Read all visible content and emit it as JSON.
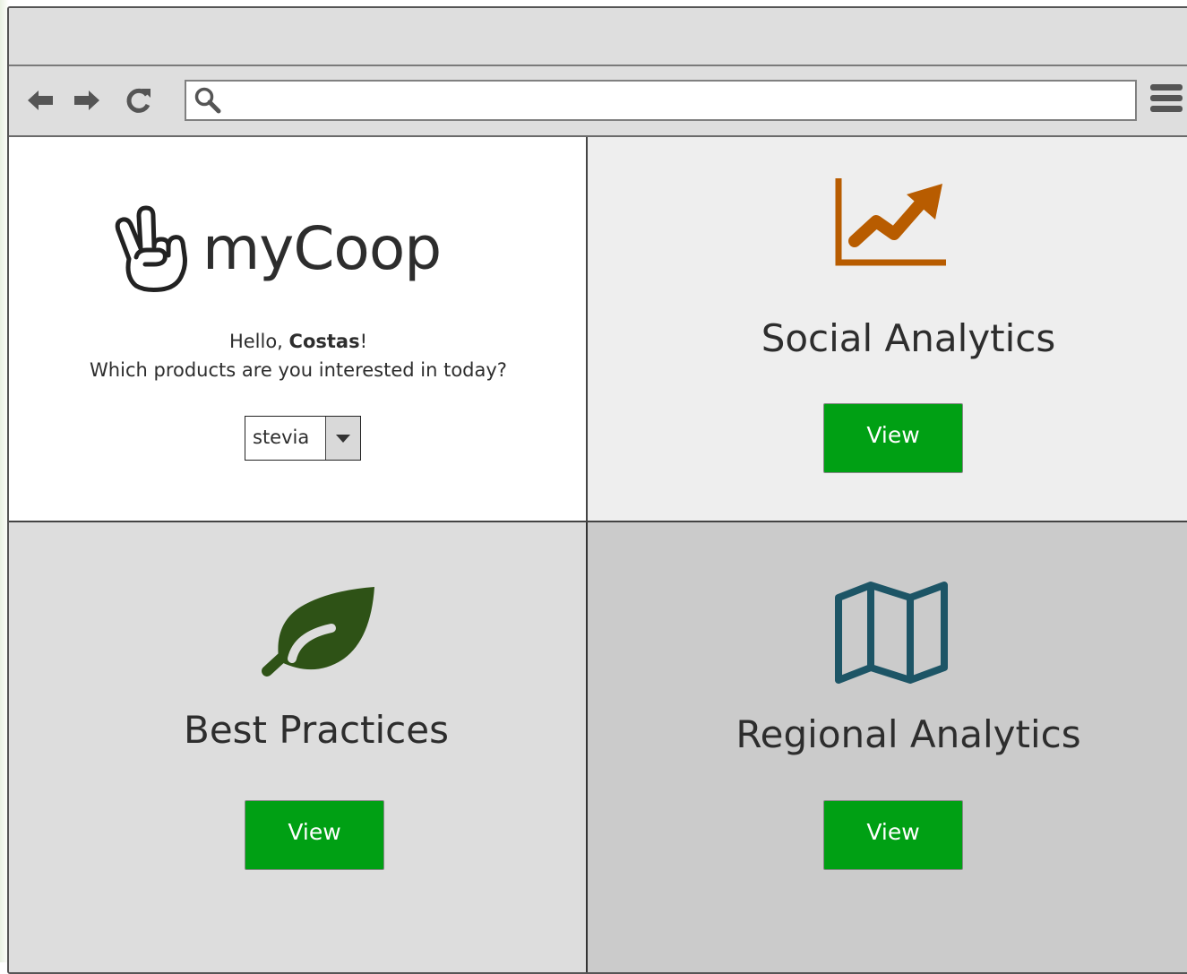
{
  "browser": {
    "address_value": "",
    "icons": [
      "back-arrow-icon",
      "forward-arrow-icon",
      "reload-icon",
      "search-icon",
      "menu-icon"
    ]
  },
  "welcome": {
    "logo_text": "myCoop",
    "logo_icon": "peace-hand-icon",
    "greeting_prefix": "Hello, ",
    "user_name": "Costas",
    "greeting_suffix": "!",
    "question": "Which products are you interested in today?",
    "product_select": {
      "selected": "stevia"
    }
  },
  "tiles": [
    {
      "title": "Social Analytics",
      "button_label": "View",
      "icon": "line-chart-icon",
      "icon_color": "#b85c00",
      "background": "#eeeeee"
    },
    {
      "title": "Best Practices",
      "button_label": "View",
      "icon": "leaf-icon",
      "icon_color": "#2e5216",
      "background": "#dddddd"
    },
    {
      "title": "Regional Analytics",
      "button_label": "View",
      "icon": "map-icon",
      "icon_color": "#1d5566",
      "background": "#cbcbcb"
    }
  ],
  "colors": {
    "button": "#00a014",
    "button_text": "#ffffff"
  }
}
